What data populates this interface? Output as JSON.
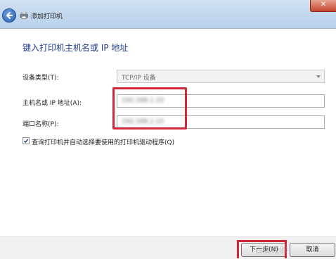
{
  "titlebar": {
    "title": "添加打印机",
    "close_glyph": "✕"
  },
  "heading": "键入打印机主机名或 IP 地址",
  "form": {
    "device_type_label": "设备类型(T):",
    "device_type_value": "TCP/IP 设备",
    "hostname_label": "主机名或 IP 地址(A):",
    "hostname_value": "192.168.1.10",
    "port_label": "端口名称(P):",
    "port_value": "192.168.1.10",
    "query_checkbox_label": "查询打印机并自动选择要使用的打印机驱动程序(Q)",
    "query_checked": true
  },
  "buttons": {
    "next": "下一步(N)",
    "cancel": "取消"
  },
  "watermark": "百度经验",
  "colors": {
    "highlight": "#d0273a",
    "heading": "#1e3a8a"
  }
}
